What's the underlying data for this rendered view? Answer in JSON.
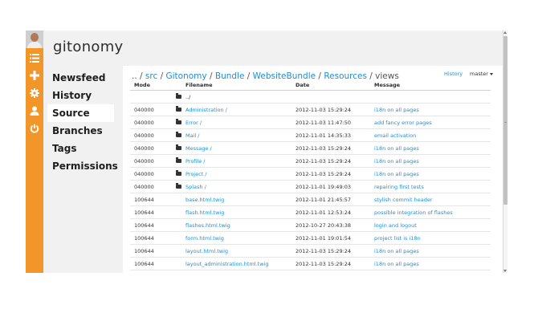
{
  "app": {
    "brand": "gitonomy"
  },
  "rail": {
    "icons": [
      "list-icon",
      "plus-icon",
      "gear-icon",
      "user-icon",
      "power-icon"
    ]
  },
  "nav": {
    "items": [
      {
        "label": "Newsfeed"
      },
      {
        "label": "History"
      },
      {
        "label": "Source",
        "active": true
      },
      {
        "label": "Branches"
      },
      {
        "label": "Tags"
      },
      {
        "label": "Permissions"
      }
    ]
  },
  "breadcrumb": {
    "prefix": "..",
    "items": [
      "src",
      "Gitonomy",
      "Bundle",
      "WebsiteBundle",
      "Resources"
    ],
    "current": "views",
    "separator": "/"
  },
  "toolbar": {
    "history_label": "History",
    "branch": "master"
  },
  "table": {
    "headers": {
      "mode": "Mode",
      "filename": "Filename",
      "date": "Date",
      "message": "Message"
    },
    "parent": "../",
    "rows": [
      {
        "mode": "040000",
        "folder": true,
        "name": "Administration /",
        "date": "2012-11-03 15:29:24",
        "message": "i18n on all pages"
      },
      {
        "mode": "040000",
        "folder": true,
        "name": "Error /",
        "date": "2012-11-03 11:47:50",
        "message": "add fancy error pages"
      },
      {
        "mode": "040000",
        "folder": true,
        "name": "Mail /",
        "date": "2012-11-01 14:35:33",
        "message": "email activation"
      },
      {
        "mode": "040000",
        "folder": true,
        "name": "Message /",
        "date": "2012-11-03 15:29:24",
        "message": "i18n on all pages"
      },
      {
        "mode": "040000",
        "folder": true,
        "name": "Profile /",
        "date": "2012-11-03 15:29:24",
        "message": "i18n on all pages"
      },
      {
        "mode": "040000",
        "folder": true,
        "name": "Project /",
        "date": "2012-11-03 15:29:24",
        "message": "i18n on all pages"
      },
      {
        "mode": "040000",
        "folder": true,
        "name": "Splash /",
        "date": "2012-11-01 19:49:03",
        "message": "repairing first tests"
      },
      {
        "mode": "100644",
        "folder": false,
        "name": "base.html.twig",
        "date": "2012-11-01 21:45:57",
        "message": "stylish commit header"
      },
      {
        "mode": "100644",
        "folder": false,
        "name": "flash.html.twig",
        "date": "2012-11-01 12:53:24",
        "message": "possible integration of flashes"
      },
      {
        "mode": "100644",
        "folder": false,
        "name": "flashes.html.twig",
        "date": "2012-10-27 20:43:38",
        "message": "login and logout"
      },
      {
        "mode": "100644",
        "folder": false,
        "name": "form.html.twig",
        "date": "2012-11-01 19:01:54",
        "message": "project list is i18n"
      },
      {
        "mode": "100644",
        "folder": false,
        "name": "layout.html.twig",
        "date": "2012-11-03 15:29:24",
        "message": "i18n on all pages"
      },
      {
        "mode": "100644",
        "folder": false,
        "name": "layout_administration.html.twig",
        "date": "2012-11-03 15:29:24",
        "message": "i18n on all pages"
      }
    ]
  },
  "colors": {
    "accent": "#f39629",
    "link": "#1f8dd6",
    "panel": "#f1f1f1"
  }
}
